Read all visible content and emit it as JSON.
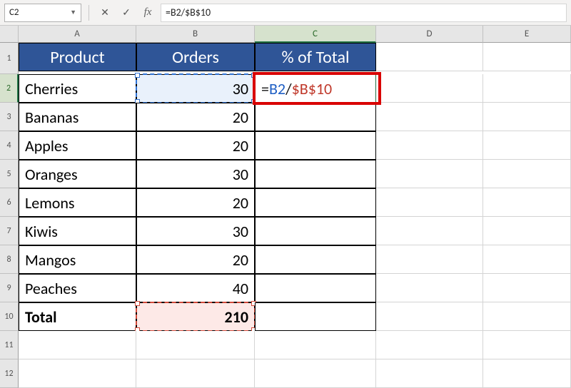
{
  "formula_bar": {
    "cell_ref": "C2",
    "cancel_icon": "✕",
    "confirm_icon": "✓",
    "fx_label": "fx",
    "formula": "=B2/$B$10"
  },
  "columns": [
    "A",
    "B",
    "C",
    "D",
    "E"
  ],
  "selected_column": "C",
  "selected_row": 2,
  "table": {
    "headers": {
      "a": "Product",
      "b": "Orders",
      "c": "% of Total"
    },
    "rows": [
      {
        "product": "Cherries",
        "orders": 30
      },
      {
        "product": "Bananas",
        "orders": 20
      },
      {
        "product": "Apples",
        "orders": 20
      },
      {
        "product": "Oranges",
        "orders": 30
      },
      {
        "product": "Lemons",
        "orders": 20
      },
      {
        "product": "Kiwis",
        "orders": 30
      },
      {
        "product": "Mangos",
        "orders": 20
      },
      {
        "product": "Peaches",
        "orders": 40
      }
    ],
    "total_label": "Total",
    "total_value": 210
  },
  "editing_cell": {
    "parts": {
      "eq": "=",
      "ref1": "B2",
      "slash": "/",
      "ref2": "$B$10"
    }
  },
  "row_numbers": [
    1,
    2,
    3,
    4,
    5,
    6,
    7,
    8,
    9,
    10,
    11,
    12
  ]
}
